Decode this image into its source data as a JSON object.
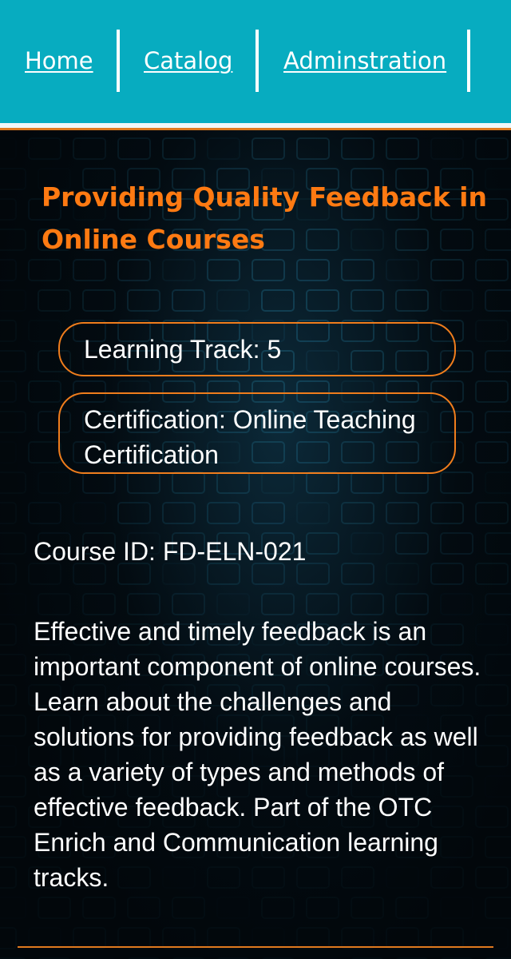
{
  "nav": {
    "items": [
      {
        "label": "Home"
      },
      {
        "label": "Catalog"
      },
      {
        "label": "Adminstration"
      }
    ]
  },
  "course": {
    "title": "Providing Quality Feedback in Online Courses",
    "learning_track": "Learning Track: 5",
    "certification": "Certification: Online Teaching Certification",
    "course_id": "Course ID: FD-ELN-021",
    "description": "Effective and timely feedback is an important component of online courses. Learn about the challenges and solutions for providing feedback as well as a variety of types and methods of effective feedback. Part of the OTC Enrich and Communication learning tracks."
  },
  "colors": {
    "nav_background": "#07acc0",
    "accent": "#ff7a12",
    "text": "#ffffff",
    "page_background": "#02070b"
  }
}
